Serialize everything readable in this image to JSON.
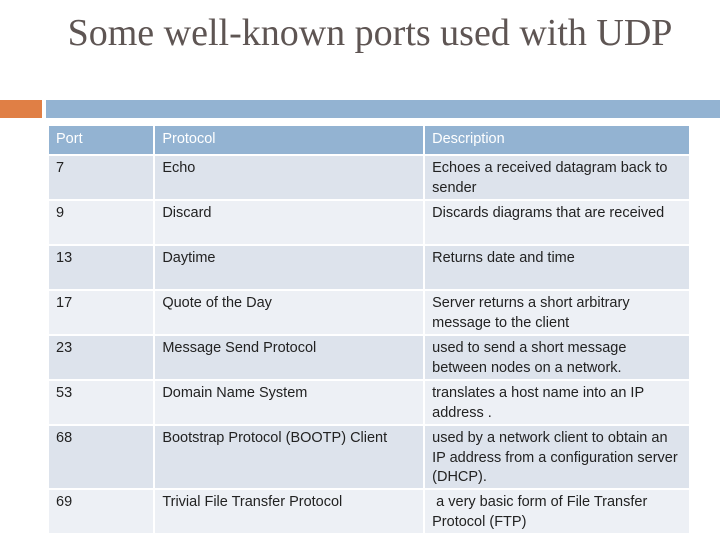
{
  "slide": {
    "title": "Some well-known ports used with UDP",
    "accent_colors": {
      "orange": "#e07f45",
      "blue": "#93b3d2"
    }
  },
  "table": {
    "headers": [
      "Port",
      "Protocol",
      "Description"
    ],
    "rows": [
      {
        "port": "7",
        "protocol": "Echo",
        "description": "Echoes a received datagram back to sender"
      },
      {
        "port": "9",
        "protocol": "Discard",
        "description": "Discards diagrams that are received"
      },
      {
        "port": "13",
        "protocol": "Daytime",
        "description": "Returns date and time"
      },
      {
        "port": "17",
        "protocol": "Quote of the Day",
        "description": "Server returns a short arbitrary message to the client"
      },
      {
        "port": "23",
        "protocol": "Message Send Protocol",
        "description": "used to send a short message between nodes on a network."
      },
      {
        "port": "53",
        "protocol": "Domain Name System",
        "description": "translates a host name into an IP address ."
      },
      {
        "port": "68",
        "protocol": "Bootstrap Protocol (BOOTP) Client",
        "description": "used by a network client to obtain an IP address from a configuration server (DHCP)."
      },
      {
        "port": "69",
        "protocol": "Trivial File Transfer Protocol",
        "description": " a very basic form of File Transfer Protocol (FTP)"
      }
    ]
  }
}
